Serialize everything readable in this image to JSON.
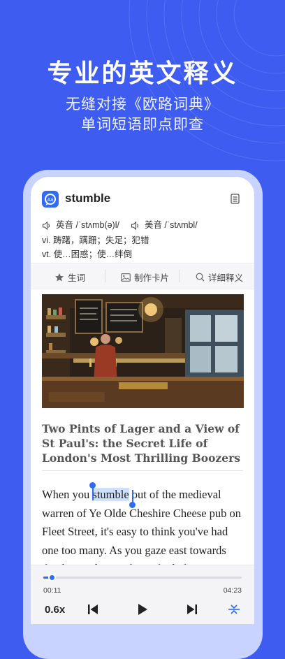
{
  "promo": {
    "headline": "专业的英文释义",
    "subline1": "无缝对接《欧路词典》",
    "subline2": "单词短语即点即查"
  },
  "dict": {
    "word": "stumble",
    "uk_label": "英音 /ˈstʌmb(ə)l/",
    "us_label": "美音 /ˈstʌmbl/",
    "def1": "vi. 踌躇，蹒跚；失足；犯错",
    "def2": "vt. 使…困惑；使…绊倒",
    "icons": {
      "app": "dictionary-app-icon",
      "doc": "note-icon",
      "speaker": "speaker-icon"
    }
  },
  "toolbar": {
    "vocab": "生词",
    "card": "制作卡片",
    "detail": "详细释义"
  },
  "article": {
    "title": "Two Pints of Lager and a View of St Paul's: the Secret Life of London's Most Thrilling Boozers",
    "body_before": "When you ",
    "highlight": "stumble",
    "body_after": " out of the medieval warren of Ye Olde Cheshire Cheese pub on Fleet Street, it's easy to think you've had one too many. As you gaze east towards the dome of St Paul's Cathedral"
  },
  "player": {
    "current": "00:11",
    "total": "04:23",
    "progress": 0.042,
    "speed": "0.6x"
  },
  "colors": {
    "background": "#3f5cf0",
    "accent": "#2f6bf3",
    "highlight": "#cfe0fb"
  }
}
